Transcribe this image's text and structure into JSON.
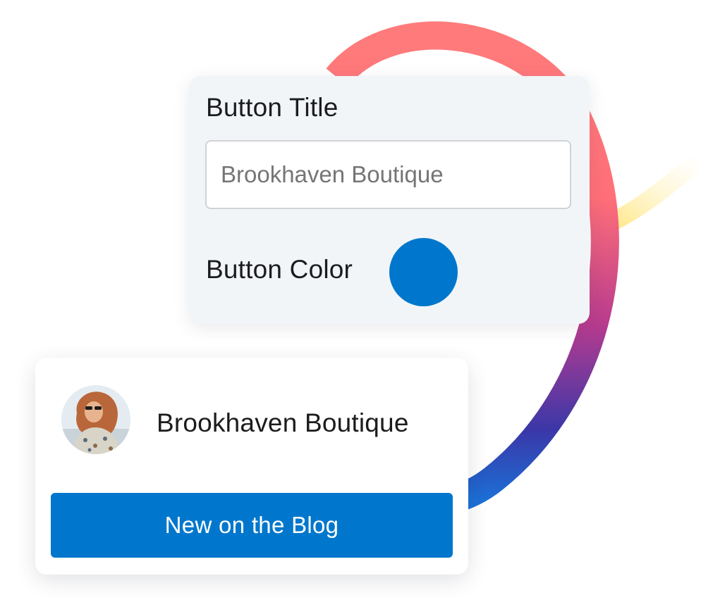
{
  "settings": {
    "title_label": "Button Title",
    "title_placeholder": "Brookhaven Boutique",
    "color_label": "Button Color",
    "color_value": "#0077cc"
  },
  "preview": {
    "profile_name": "Brookhaven Boutique",
    "button_label": "New on the Blog",
    "button_color": "#0077cc"
  },
  "decor": {
    "stroke_gradient": [
      "#ff7b7b",
      "#ff6f78",
      "#b83b8e",
      "#3a37a8",
      "#1c6fd6"
    ],
    "glow_color": "#ffe680"
  }
}
